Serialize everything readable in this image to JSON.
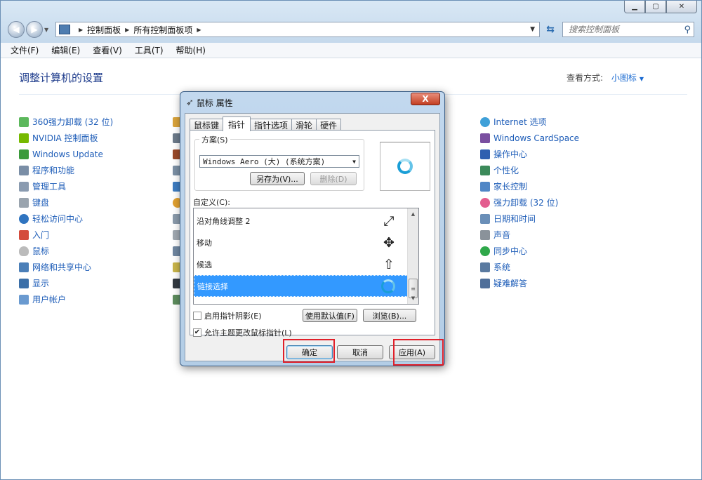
{
  "explorer": {
    "breadcrumb": [
      "控制面板",
      "所有控制面板项"
    ],
    "search_placeholder": "搜索控制面板",
    "menu": [
      "文件(F)",
      "编辑(E)",
      "查看(V)",
      "工具(T)",
      "帮助(H)"
    ],
    "page_title": "调整计算机的设置",
    "view_mode_label": "查看方式:",
    "view_mode_value": "小图标",
    "items_left": [
      "360强力卸载 (32 位)",
      "NVIDIA 控制面板",
      "Windows Update",
      "程序和功能",
      "管理工具",
      "键盘",
      "轻松访问中心",
      "入门",
      "鼠标",
      "网络和共享中心",
      "显示",
      "用户帐户"
    ],
    "items_right": [
      "Internet 选项",
      "Windows CardSpace",
      "操作中心",
      "个性化",
      "家长控制",
      "强力卸载 (32 位)",
      "日期和时间",
      "声音",
      "同步中心",
      "系统",
      "疑难解答"
    ]
  },
  "dialog": {
    "title": "鼠标 属性",
    "close_glyph": "X",
    "tabs": [
      "鼠标键",
      "指针",
      "指针选项",
      "滑轮",
      "硬件"
    ],
    "active_tab_index": 1,
    "scheme_label": "方案(S)",
    "scheme_value": "Windows Aero (大) (系统方案)",
    "save_as_label": "另存为(V)...",
    "delete_label": "删除(D)",
    "custom_label": "自定义(C):",
    "cursors": [
      {
        "name": "沿对角线调整 2",
        "icon": "diagonal-resize-icon",
        "glyph": "⤢"
      },
      {
        "name": "移动",
        "icon": "move-icon",
        "glyph": "✥"
      },
      {
        "name": "候选",
        "icon": "alternate-select-icon",
        "glyph": "⇧"
      },
      {
        "name": "链接选择",
        "icon": "link-select-icon",
        "glyph": ""
      }
    ],
    "selected_cursor_index": 3,
    "shadow_label": "启用指针阴影(E)",
    "shadow_checked": false,
    "use_default_label": "使用默认值(F)",
    "browse_label": "浏览(B)...",
    "allow_theme_label": "允许主题更改鼠标指针(L)",
    "allow_theme_checked": true,
    "ok_label": "确定",
    "cancel_label": "取消",
    "apply_label": "应用(A)"
  },
  "colors": {
    "link_blue": "#1e5db8",
    "title_blue": "#1e3c8c",
    "selection": "#3399ff",
    "highlight_box": "#e0202a"
  }
}
